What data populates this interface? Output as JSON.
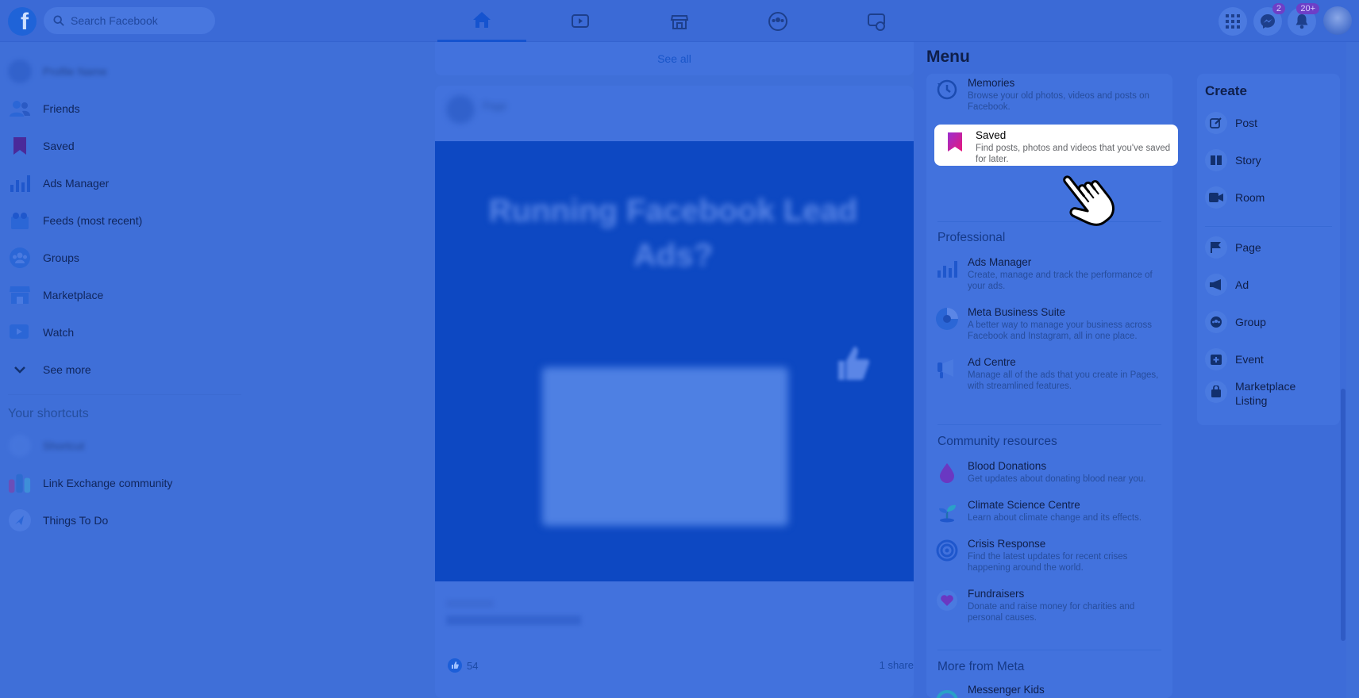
{
  "topbar": {
    "search_placeholder": "Search Facebook",
    "messenger_badge": "2",
    "notifications_badge": "20+"
  },
  "sidebar": {
    "profile_name": "Profile Name",
    "items": [
      {
        "label": "Friends",
        "icon": "friends-icon"
      },
      {
        "label": "Saved",
        "icon": "bookmark-icon"
      },
      {
        "label": "Ads Manager",
        "icon": "bar-chart-icon"
      },
      {
        "label": "Feeds (most recent)",
        "icon": "feeds-icon"
      },
      {
        "label": "Groups",
        "icon": "groups-icon"
      },
      {
        "label": "Marketplace",
        "icon": "marketplace-icon"
      },
      {
        "label": "Watch",
        "icon": "watch-icon"
      },
      {
        "label": "See more",
        "icon": "chevron-down-icon"
      }
    ],
    "shortcuts_title": "Your shortcuts",
    "shortcuts": [
      {
        "label": "Shortcut"
      },
      {
        "label": "Link Exchange community"
      },
      {
        "label": "Things To Do"
      }
    ]
  },
  "feed": {
    "see_all": "See all",
    "post": {
      "author": "Page",
      "image_title": "Running Facebook Lead Ads?",
      "reactions": "54",
      "shares": "1 share"
    }
  },
  "menu": {
    "title": "Menu",
    "top_items": [
      {
        "name": "Memories",
        "desc": "Browse your old photos, videos and posts on Facebook."
      },
      {
        "name": "Saved",
        "desc": "Find posts, photos and videos that you've saved for later."
      }
    ],
    "professional": {
      "title": "Professional",
      "items": [
        {
          "name": "Ads Manager",
          "desc": "Create, manage and track the performance of your ads."
        },
        {
          "name": "Meta Business Suite",
          "desc": "A better way to manage your business across Facebook and Instagram, all in one place."
        },
        {
          "name": "Ad Centre",
          "desc": "Manage all of the ads that you create in Pages, with streamlined features."
        }
      ]
    },
    "community": {
      "title": "Community resources",
      "items": [
        {
          "name": "Blood Donations",
          "desc": "Get updates about donating blood near you."
        },
        {
          "name": "Climate Science Centre",
          "desc": "Learn about climate change and its effects."
        },
        {
          "name": "Crisis Response",
          "desc": "Find the latest updates for recent crises happening around the world."
        },
        {
          "name": "Fundraisers",
          "desc": "Donate and raise money for charities and personal causes."
        }
      ]
    },
    "more": {
      "title": "More from Meta",
      "items": [
        {
          "name": "Messenger Kids"
        }
      ]
    },
    "create": {
      "title": "Create",
      "items": [
        "Post",
        "Story",
        "Room",
        "Page",
        "Ad",
        "Group",
        "Event",
        "Marketplace Listing"
      ]
    }
  },
  "colors": {
    "overlay_blue": "#3f6fd8",
    "highlight": "#ffffff",
    "saved_icon": "#c2187a"
  }
}
